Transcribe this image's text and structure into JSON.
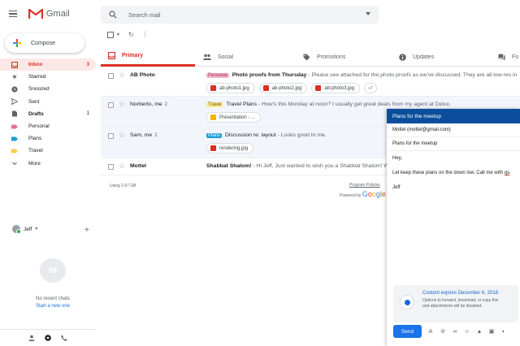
{
  "app": {
    "logo_text": "Gmail"
  },
  "search": {
    "placeholder": "Search mail"
  },
  "compose": {
    "label": "Compose"
  },
  "sidebar": {
    "items": [
      {
        "label": "Inbox",
        "count": "3",
        "icon": "inbox-icon"
      },
      {
        "label": "Starred",
        "count": "",
        "icon": "star-icon"
      },
      {
        "label": "Snoozed",
        "count": "",
        "icon": "clock-icon"
      },
      {
        "label": "Sent",
        "count": "",
        "icon": "send-icon"
      },
      {
        "label": "Drafts",
        "count": "1",
        "icon": "draft-icon"
      },
      {
        "label": "Personal",
        "count": "",
        "icon": "label-icon",
        "color": "#e46f9c"
      },
      {
        "label": "Plans",
        "count": "",
        "icon": "label-icon",
        "color": "#1a9bd8"
      },
      {
        "label": "Travel",
        "count": "",
        "icon": "label-icon",
        "color": "#f4d03f"
      },
      {
        "label": "More",
        "count": "",
        "icon": "chevron-down-icon"
      }
    ]
  },
  "hangouts": {
    "user": "Jeff",
    "bubble_text": "99",
    "empty_text": "No recent chats",
    "start_link": "Start a new one"
  },
  "tabs": [
    {
      "label": "Primary"
    },
    {
      "label": "Social"
    },
    {
      "label": "Promotions"
    },
    {
      "label": "Updates"
    },
    {
      "label": "Fo"
    }
  ],
  "emails": [
    {
      "sender": "AB Photo",
      "count": "",
      "label": "Personal",
      "label_bg": "#f4b6c8",
      "label_fg": "#a0305a",
      "subject": "Photo proofs from Thursday",
      "snippet": " - Please see attached for the photo proofs as we've discussed. They are all low-res in",
      "attachments": [
        "ab-photo1.jpg",
        "ab-photo2.jpg",
        "ab-photo3.jpg"
      ],
      "more": "+7"
    },
    {
      "sender": "Norberto, me",
      "count": "2",
      "label": "Travel",
      "label_bg": "#fbe790",
      "label_fg": "#7a5a00",
      "subject": "Travel Plans",
      "snippet": " - How's this Monday at noon? I usually get great deals from my agent at Delux.",
      "attachments": [
        "Presentation - ..."
      ],
      "more": ""
    },
    {
      "sender": "Sam, me",
      "count": "2",
      "label": "Plans",
      "label_bg": "#1a9bd8",
      "label_fg": "#ffffff",
      "subject": "Discussion re: layout",
      "snippet": " - Looks good to me.",
      "attachments": [
        "rendering.jpg"
      ],
      "more": ""
    },
    {
      "sender": "Mottel",
      "count": "",
      "label": "",
      "label_bg": "",
      "label_fg": "",
      "subject": "Shabbat Shalom!",
      "snippet": " - Hi Jeff, Just wanted to wish you a Shabbat Shalom! We",
      "attachments": [],
      "more": ""
    }
  ],
  "footer": {
    "storage": "Using 2.67 GB",
    "policies": "Program Policies",
    "powered_by": "Powered by",
    "google": "Google"
  },
  "compose_window": {
    "title": "Plans for the meetup",
    "to": "Mottel (mottel@gmail.com)",
    "subject": "Plans for the meetup",
    "body_greeting": "Hey,",
    "body_main": "Let keep these plans on the down low. Call me with ",
    "body_underlined": "qs",
    "body_sign": "Jeff",
    "confidential_title": "Content expires December 6, 2018",
    "confidential_line1": "Options to forward, download, or copy this",
    "confidential_line2": "and attachments will be disabled.",
    "send_label": "Send"
  },
  "colors": {
    "accent_red": "#d93025",
    "compose_header": "#0b4f9c",
    "send_blue": "#1a73e8"
  }
}
